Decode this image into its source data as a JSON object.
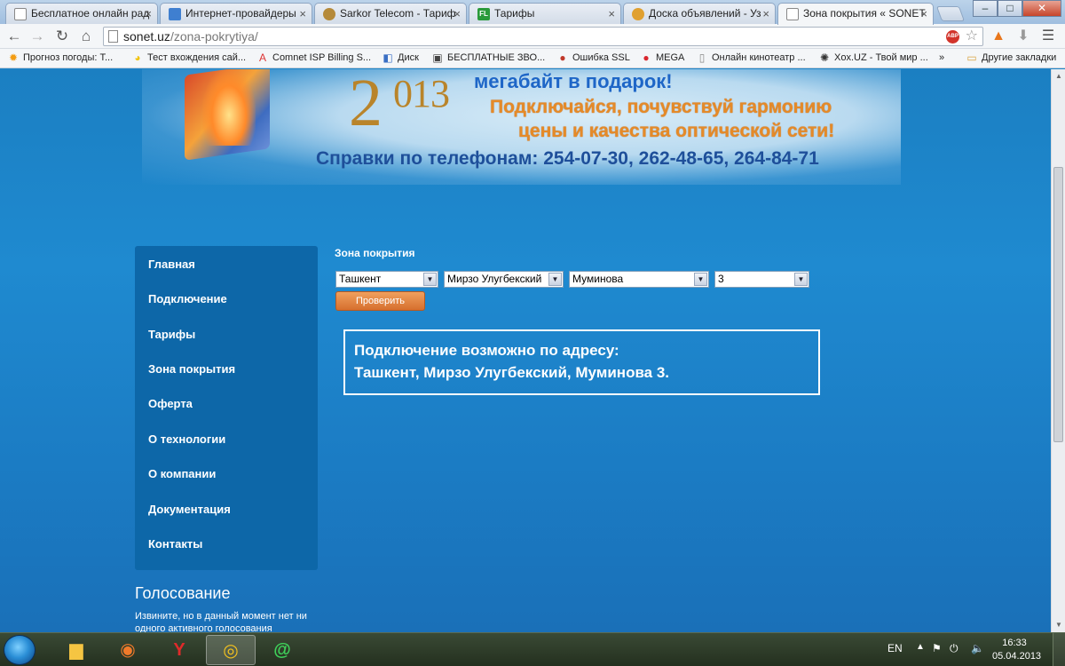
{
  "browser": {
    "tabs": [
      {
        "title": "Бесплатное онлайн рад",
        "icon": "page-icon",
        "active": false
      },
      {
        "title": "Интернет-провайдеры",
        "icon": "provider-icon",
        "active": false
      },
      {
        "title": "Sarkor Telecom - Тариф",
        "icon": "sarkor-icon",
        "active": false
      },
      {
        "title": "Тарифы",
        "icon": "fl-icon",
        "active": false
      },
      {
        "title": "Доска объявлений - Уз",
        "icon": "board-icon",
        "active": false
      },
      {
        "title": "Зона покрытия « SONET",
        "icon": "page-icon",
        "active": true
      }
    ],
    "window_buttons": {
      "minimize": "–",
      "maximize": "□",
      "close": "✕"
    },
    "url": {
      "host": "sonet.uz",
      "path": "/zona-pokrytiya/"
    },
    "bookmarks": [
      {
        "label": "Прогноз погоды: Т...",
        "icon": "sun-icon"
      },
      {
        "label": "Тест вхождения сай...",
        "icon": "pacman-icon"
      },
      {
        "label": "Comnet ISP Billing S...",
        "icon": "comnet-icon"
      },
      {
        "label": "Диск",
        "icon": "disk-icon"
      },
      {
        "label": "БЕСПЛАТНЫЕ ЗВО...",
        "icon": "phone-icon"
      },
      {
        "label": "Ошибка SSL",
        "icon": "opera-icon"
      },
      {
        "label": "MEGA",
        "icon": "mega-icon"
      },
      {
        "label": "Онлайн кинотеатр ...",
        "icon": "page-icon"
      },
      {
        "label": "Xox.UZ - Твой мир ...",
        "icon": "xox-icon"
      }
    ],
    "bookmarks_more": "»",
    "other_bookmarks": "Другие закладки"
  },
  "banner": {
    "year_digit": "2",
    "year_rest": "013",
    "line1": "мегабайт в подарок!",
    "line2": "Подключайся, почувствуй гармонию",
    "line3": "цены и качества оптической сети!",
    "phones": "Справки по телефонам: 254-07-30, 262-48-65, 264-84-71"
  },
  "sidebar": {
    "items": [
      {
        "label": "Главная"
      },
      {
        "label": "Подключение"
      },
      {
        "label": "Тарифы"
      },
      {
        "label": "Зона покрытия"
      },
      {
        "label": "Оферта"
      },
      {
        "label": "О технологии"
      },
      {
        "label": "О компании"
      },
      {
        "label": "Документация"
      },
      {
        "label": "Контакты"
      }
    ]
  },
  "voting": {
    "title": "Голосование",
    "text": "Извините, но в данный момент нет ни одного активного голосования"
  },
  "coverage": {
    "title": "Зона покрытия",
    "city": "Ташкент",
    "district": "Мирзо Улугбекский",
    "street": "Муминова",
    "house": "3",
    "check_button": "Проверить",
    "result_line1": "Подключение возможно по адресу:",
    "result_line2": "Ташкент, Мирзо Улугбекский, Муминова 3."
  },
  "taskbar": {
    "language": "EN",
    "time": "16:33",
    "date": "05.04.2013"
  },
  "colors": {
    "page_bg": "#1f86c9",
    "sidebar_bg": "#0d67a8",
    "button_orange": "#e0803c",
    "promo_orange": "#e58a28",
    "phones_blue": "#1e4f9a"
  }
}
